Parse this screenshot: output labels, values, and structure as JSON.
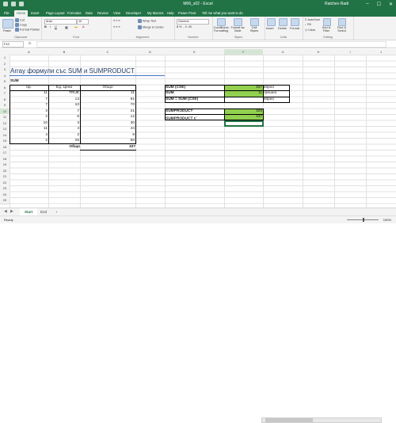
{
  "window": {
    "title": "M06_s02  -  Excel",
    "user": "Ratchev Radi"
  },
  "ribbon_tabs": [
    "File",
    "Home",
    "Insert",
    "Page Layout",
    "Formulas",
    "Data",
    "Review",
    "View",
    "Developer",
    "My Macros",
    "Help",
    "Power Pivot",
    "Tell me what you want to do"
  ],
  "ribbon": {
    "clipboard": {
      "label": "Clipboard",
      "paste": "Paste",
      "cut": "Cut",
      "copy": "Copy",
      "format_painter": "Format Painter"
    },
    "font": {
      "label": "Font",
      "font_name": "Arial",
      "font_size": "10"
    },
    "alignment": {
      "label": "Alignment",
      "wrap_text": "Wrap Text",
      "merge_center": "Merge & Center"
    },
    "number": {
      "label": "Number",
      "format": "General"
    },
    "styles": {
      "label": "Styles",
      "conditional": "Conditional Formatting",
      "format_table": "Format as Table",
      "cell_styles": "Cell Styles"
    },
    "cells": {
      "label": "Cells",
      "insert": "Insert",
      "delete": "Delete",
      "format": "Format"
    },
    "editing": {
      "label": "Editing",
      "autosum": "AutoSum",
      "fill": "Fill",
      "clear": "Clear",
      "sort_filter": "Sort & Filter",
      "find_select": "Find & Select"
    }
  },
  "formula_bar": {
    "name_box": "F10",
    "fx": "fx",
    "formula": ""
  },
  "columns": [
    "A",
    "B",
    "C",
    "D",
    "E",
    "F",
    "G",
    "H",
    "I",
    "J"
  ],
  "rows": [
    "1",
    "2",
    "3",
    "4",
    "5",
    "6",
    "7",
    "8",
    "9",
    "10",
    "11",
    "12",
    "13",
    "14",
    "15",
    "16",
    "17",
    "18",
    "19",
    "20",
    "21",
    "22",
    "23",
    "24",
    "25"
  ],
  "sheet": {
    "title": "Array формули със SUM и SUMPRODUCT",
    "section": "SUM",
    "headers": {
      "a": "бр.",
      "b": "Ед. Цена",
      "c": "Общо"
    },
    "table": [
      {
        "a": "11",
        "b": "TRUE",
        "c": "11"
      },
      {
        "a": "7",
        "b": "13",
        "c": "91"
      },
      {
        "a": "7",
        "b": "10",
        "c": "70"
      },
      {
        "a": "3",
        "b": "7",
        "c": "21"
      },
      {
        "a": "2",
        "b": "6",
        "c": "12"
      },
      {
        "a": "10",
        "b": "3",
        "c": "30"
      },
      {
        "a": "11",
        "b": "4",
        "c": "44"
      },
      {
        "a": "4",
        "b": "2",
        "c": "8"
      },
      {
        "a": "2",
        "b": "25",
        "c": "50"
      }
    ],
    "total_label": "Общо",
    "total_value": "337",
    "checks": [
      {
        "label": "SUM (CSE)",
        "value": "337",
        "note": "вярно"
      },
      {
        "label": "SUM",
        "value": "11",
        "note": "грешно"
      },
      {
        "label": "SUM = SUM (CSE)",
        "value": "",
        "note": "вярно"
      }
    ],
    "sumproduct": [
      {
        "label": "SUMPRODUCT",
        "value": "326"
      },
      {
        "label": "SUMPRODUCT с",
        "sup": "-- ",
        "value": "337"
      }
    ]
  },
  "sheet_tabs": {
    "active": "Start",
    "other": "End",
    "add": "+"
  },
  "status": {
    "ready": "Ready",
    "zoom": "100%"
  },
  "colors": {
    "excel_green": "#217346",
    "highlight": "#92d050"
  }
}
